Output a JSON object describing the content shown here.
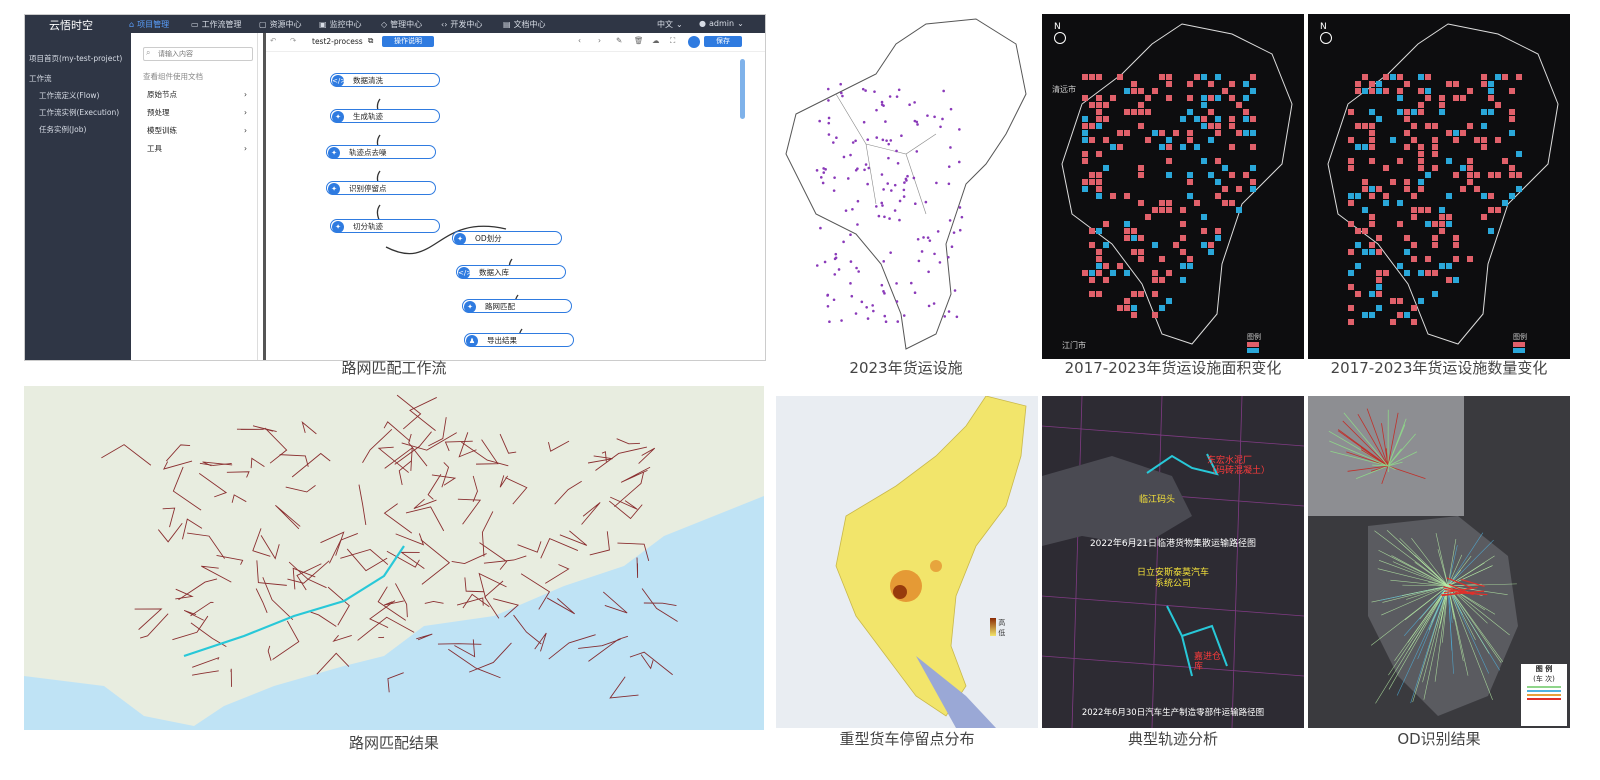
{
  "captions": {
    "workflow": "路网匹配工作流",
    "facilities_2023": "2023年货运设施",
    "area_change": "2017-2023年货运设施面积变化",
    "count_change": "2017-2023年货运设施数量变化",
    "match_result": "路网匹配结果",
    "truck_stops": "重型货车停留点分布",
    "trajectory": "典型轨迹分析",
    "od": "OD识别结果"
  },
  "app": {
    "logo": "云悟时空",
    "nav": [
      "项目管理",
      "工作流管理",
      "资源中心",
      "监控中心",
      "管理中心",
      "开发中心",
      "文档中心"
    ],
    "lang": "中文",
    "user": "admin",
    "sidebar": [
      "项目首页(my-test-project)",
      "工作流",
      "工作流定义(Flow)",
      "工作流实例(Execution)",
      "任务实例(Job)"
    ],
    "library": {
      "search_placeholder": "请输入内容",
      "doc_link": "查看组件使用文档",
      "items": [
        "原始节点",
        "预处理",
        "模型训练",
        "工具"
      ]
    },
    "toolbar": {
      "process_name": "test2-process",
      "help": "操作说明",
      "save": "保存"
    },
    "nodes": [
      "数据清洗",
      "生成轨迹",
      "轨迹点去噪",
      "识别停留点",
      "切分轨迹",
      "OD划分",
      "数据入库",
      "路网匹配",
      "导出结果"
    ]
  },
  "maps": {
    "north": "N",
    "city_qingyuan": "清远市",
    "city_jiangmen": "江门市",
    "legend_label": "图例",
    "heat_high": "高",
    "heat_low": "低",
    "traj_a_title": "2022年6月21日临港货物集散运输路径图",
    "traj_a_label1": "临江码头",
    "traj_a_label2": "东宏水泥厂",
    "traj_a_label3": "（码砖混凝土）",
    "traj_b_title": "2022年6月30日汽车生产制造零部件运输路径图",
    "traj_b_label1": "日立安斯泰莫汽车",
    "traj_b_label2": "系统公司",
    "traj_b_label3": "嘉进仓",
    "traj_b_label4": "库",
    "od_legend_title": "图 例",
    "od_legend_sub": "(车 次)"
  },
  "colors": {
    "red_cell": "#e0606a",
    "blue_cell": "#2aa7d9",
    "road_red": "#7a0f12",
    "route_cyan": "#28c8d8",
    "heat_yellow": "#f2e56b",
    "accent": "#2f7be0"
  }
}
